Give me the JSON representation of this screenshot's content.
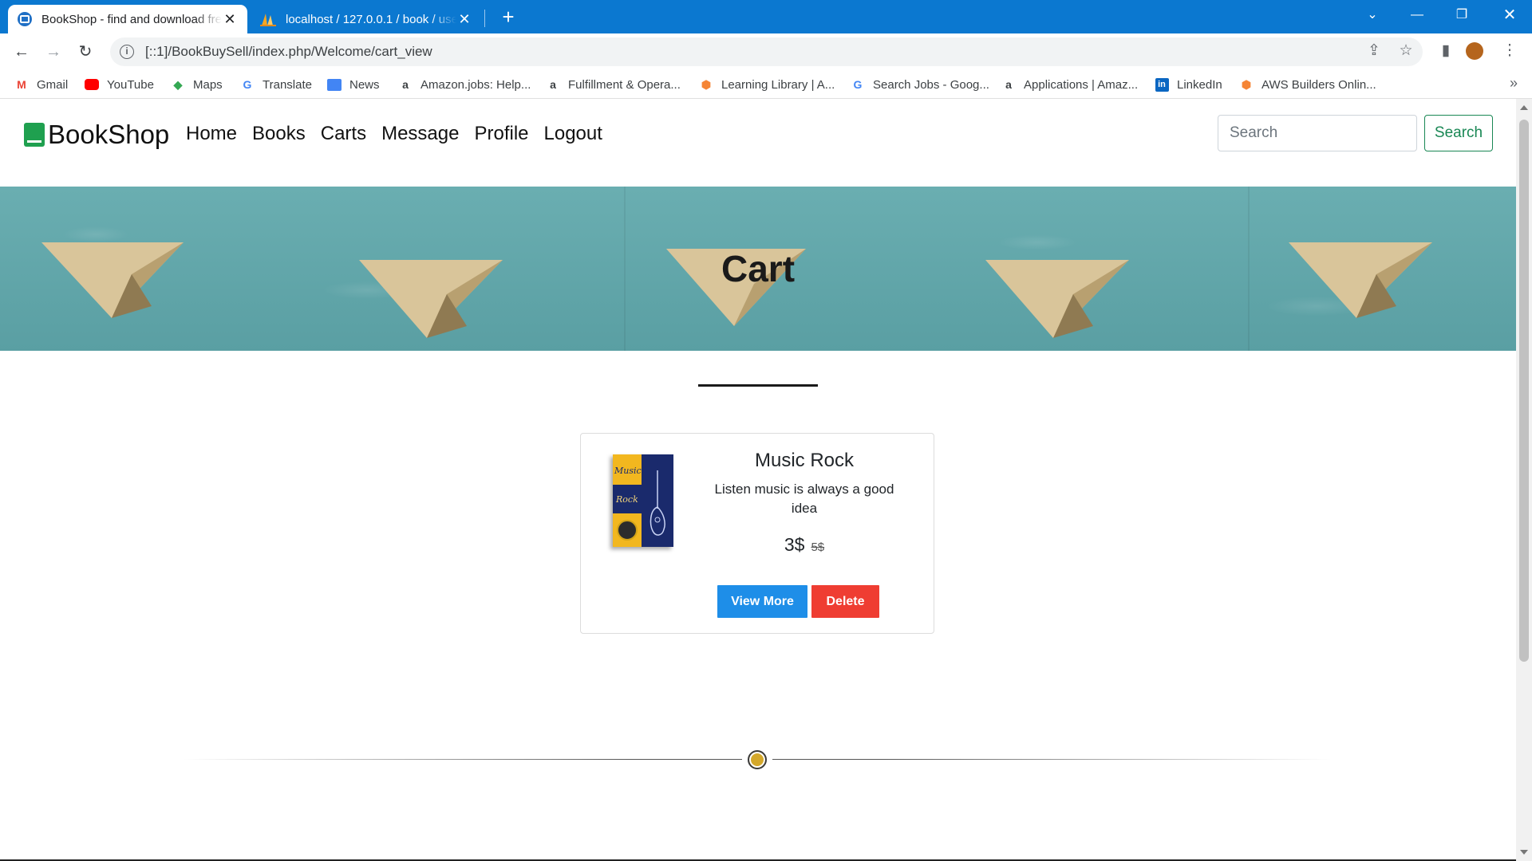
{
  "browser": {
    "tabs": [
      {
        "title": "BookShop - find and download free books",
        "active": true,
        "icon": "bookshop-favicon"
      },
      {
        "title": "localhost / 127.0.0.1 / book / users",
        "active": false,
        "icon": "phpmyadmin-favicon"
      }
    ],
    "url": "[::1]/BookBuySell/index.php/Welcome/cart_view",
    "bookmarks": [
      {
        "label": "Gmail",
        "icon": "gmail-icon",
        "color": "#ea4335"
      },
      {
        "label": "YouTube",
        "icon": "youtube-icon",
        "color": "#ff0000"
      },
      {
        "label": "Maps",
        "icon": "maps-icon",
        "color": "#34a853"
      },
      {
        "label": "Translate",
        "icon": "translate-icon",
        "color": "#4285f4"
      },
      {
        "label": "News",
        "icon": "news-icon",
        "color": "#4285f4"
      },
      {
        "label": "Amazon.jobs: Help...",
        "icon": "amazon-icon",
        "color": "#000000"
      },
      {
        "label": "Fulfillment & Opera...",
        "icon": "amazon-icon",
        "color": "#000000"
      },
      {
        "label": "Learning Library | A...",
        "icon": "aws-icon",
        "color": "#f58536"
      },
      {
        "label": "Search Jobs - Goog...",
        "icon": "google-icon",
        "color": "#4285f4"
      },
      {
        "label": "Applications | Amaz...",
        "icon": "amazon-icon",
        "color": "#000000"
      },
      {
        "label": "LinkedIn",
        "icon": "linkedin-icon",
        "color": "#0a66c2"
      },
      {
        "label": "AWS Builders Onlin...",
        "icon": "aws-icon",
        "color": "#f58536"
      }
    ]
  },
  "site": {
    "brand": "BookShop",
    "nav": [
      "Home",
      "Books",
      "Carts",
      "Message",
      "Profile",
      "Logout"
    ],
    "search_placeholder": "Search",
    "search_button": "Search",
    "accent_color": "#198754"
  },
  "banner": {
    "title": "Cart"
  },
  "cart": {
    "items": [
      {
        "title": "Music Rock",
        "description": "Listen music is always a good idea",
        "price": "3$",
        "old_price": "5$",
        "cover_text_1": "Music",
        "cover_text_2": "Rock",
        "view_button": "View More",
        "delete_button": "Delete"
      }
    ]
  }
}
